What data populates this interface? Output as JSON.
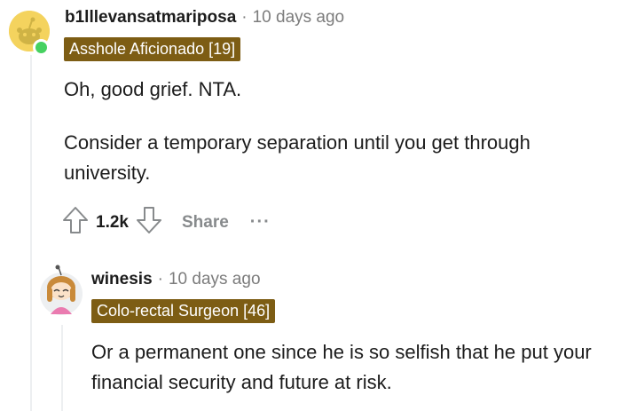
{
  "comments": [
    {
      "username": "b1lllevansatmariposa",
      "separator": "·",
      "time": "10 days ago",
      "flair": "Asshole Aficionado [19]",
      "paragraphs": [
        "Oh, good grief. NTA.",
        "Consider a temporary separation until you get through university."
      ],
      "score": "1.2k",
      "share_label": "Share",
      "more_label": "···"
    },
    {
      "username": "winesis",
      "separator": "·",
      "time": "10 days ago",
      "flair": "Colo-rectal Surgeon [46]",
      "paragraphs": [
        "Or a permanent one since he is so selfish that he put your financial security and future at risk."
      ]
    }
  ],
  "colors": {
    "flair_bg": "#7d5d14",
    "online": "#46d160",
    "muted": "#7c7c7c",
    "thread_line": "#edeff1"
  },
  "icons": {
    "upvote": "arrow-up-icon",
    "downvote": "arrow-down-icon",
    "more": "ellipsis-icon"
  }
}
